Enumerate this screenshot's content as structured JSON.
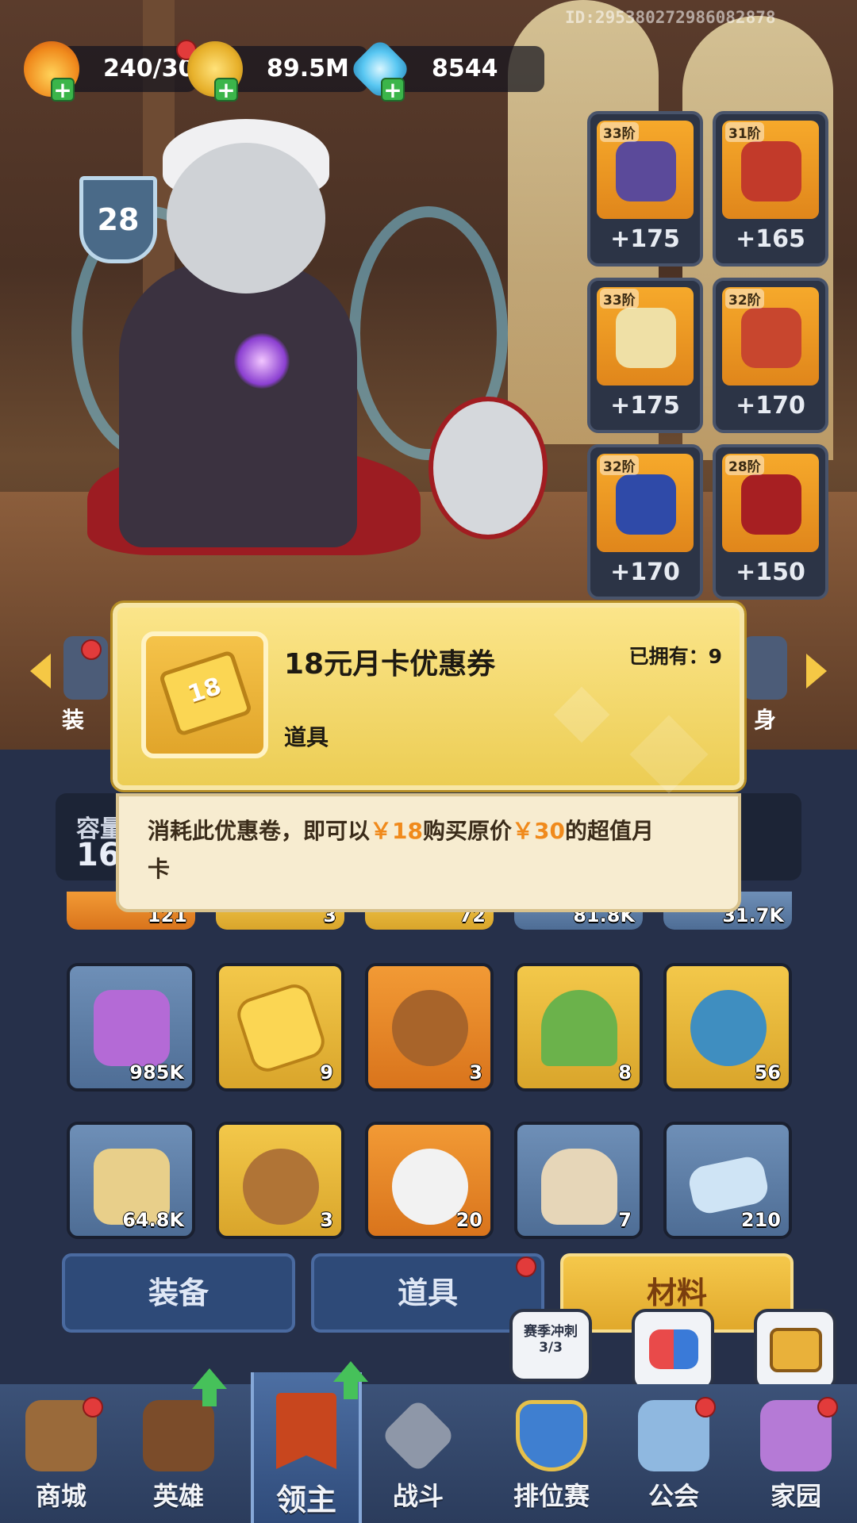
{
  "player_id": "ID:2953802729860828​78",
  "resources": [
    {
      "name": "stamina",
      "icon": "flame-icon",
      "value": "240/30",
      "color": "#f5a623"
    },
    {
      "name": "gold",
      "icon": "coin-icon",
      "value": "89.5M",
      "color": "#f2c230"
    },
    {
      "name": "crystal",
      "icon": "crystal-icon",
      "value": "8544",
      "color": "#59c7f2"
    }
  ],
  "hero_level": "28",
  "equipment": [
    {
      "tier": "33阶",
      "bonus": "+175",
      "icon": "helmet-icon"
    },
    {
      "tier": "31阶",
      "bonus": "+165",
      "icon": "armor-icon"
    },
    {
      "tier": "33阶",
      "bonus": "+175",
      "icon": "boots-icon"
    },
    {
      "tier": "32阶",
      "bonus": "+170",
      "icon": "gauntlet-icon"
    },
    {
      "tier": "32阶",
      "bonus": "+170",
      "icon": "cape-icon"
    },
    {
      "tier": "28阶",
      "bonus": "+150",
      "icon": "belt-icon"
    }
  ],
  "side_labels": {
    "left": "装",
    "right": "身"
  },
  "capacity": {
    "label": "容量",
    "value": "16"
  },
  "partial_row": [
    "121",
    "3",
    "72",
    "81.8K",
    "31.7K"
  ],
  "inventory": [
    {
      "icon": "purple-ore-icon",
      "count": "985K",
      "style": "blue"
    },
    {
      "icon": "coupon-18-icon",
      "count": "9",
      "style": "gold"
    },
    {
      "icon": "golden-bowl-icon",
      "count": "3",
      "style": "orange"
    },
    {
      "icon": "herb-icon",
      "count": "8",
      "style": "gold"
    },
    {
      "icon": "moon-scroll-icon",
      "count": "56",
      "style": "gold"
    },
    {
      "icon": "blueprint-icon",
      "count": "64.8K",
      "style": "blue"
    },
    {
      "icon": "bowl-icon",
      "count": "3",
      "style": "gold"
    },
    {
      "icon": "bear-toy-icon",
      "count": "20",
      "style": "orange"
    },
    {
      "icon": "sack-icon",
      "count": "7",
      "style": "blue"
    },
    {
      "icon": "speedup-ticket-icon",
      "count": "210",
      "style": "blue"
    }
  ],
  "tabs": [
    {
      "label": "装备",
      "active": false
    },
    {
      "label": "道具",
      "active": false
    },
    {
      "label": "材料",
      "active": true
    }
  ],
  "floating": {
    "season": {
      "title": "赛季冲刺",
      "progress": "3/3"
    }
  },
  "nav": [
    {
      "label": "商城",
      "icon": "shop-icon"
    },
    {
      "label": "英雄",
      "icon": "hero-card-icon"
    },
    {
      "label": "领主",
      "icon": "lord-banner-icon"
    },
    {
      "label": "战斗",
      "icon": "crossed-swords-icon"
    },
    {
      "label": "排位赛",
      "icon": "rank-shield-icon"
    },
    {
      "label": "公会",
      "icon": "guild-icon"
    },
    {
      "label": "家园",
      "icon": "home-castle-icon"
    }
  ],
  "popup": {
    "name": "18元月卡优惠券",
    "owned_label": "已拥有：",
    "owned_value": "9",
    "type": "道具",
    "icon_text": "18",
    "desc_1": "消耗此优惠卷，即可以",
    "desc_price1": "￥18",
    "desc_2": "购买原价",
    "desc_price2": "￥30",
    "desc_3": "的超值月",
    "desc_4": "卡"
  }
}
